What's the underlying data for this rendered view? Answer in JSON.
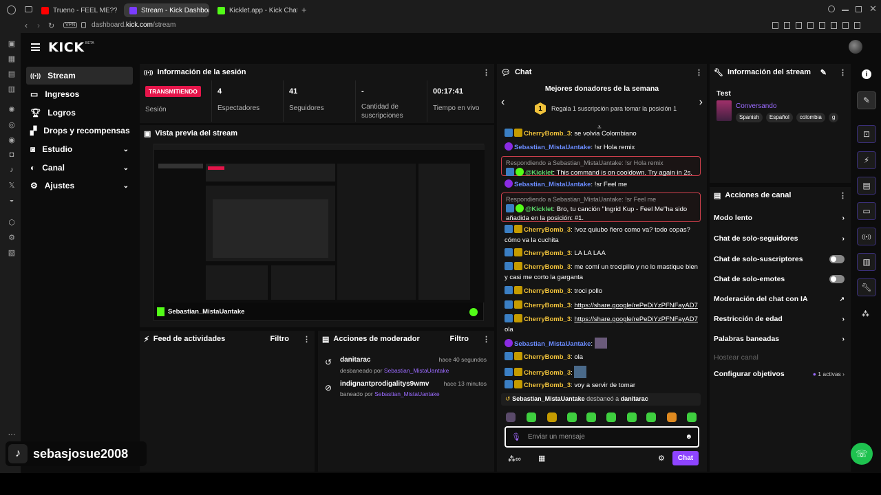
{
  "browser": {
    "tabs": [
      {
        "title": "Trueno - FEEL ME?? (Vide",
        "color": "#ff0000"
      },
      {
        "title": "Stream - Kick Dashboard",
        "color": "#7a3cff"
      },
      {
        "title": "Kicklet.app - Kick Chatbo",
        "color": "#53fc18"
      }
    ],
    "url_prefix": "dashboard.",
    "url_domain": "kick.com",
    "url_path": "/stream",
    "vpn": "VPN"
  },
  "logo": "KICK",
  "logo_beta": "BETA",
  "nav": [
    {
      "label": "Stream",
      "icon": "broadcast-icon"
    },
    {
      "label": "Ingresos",
      "icon": "money-icon"
    },
    {
      "label": "Logros",
      "icon": "trophy-icon"
    },
    {
      "label": "Drops y recompensas",
      "icon": "gift-icon"
    },
    {
      "label": "Estudio",
      "icon": "studio-icon"
    },
    {
      "label": "Canal",
      "icon": "channel-icon"
    },
    {
      "label": "Ajustes",
      "icon": "gear-icon"
    }
  ],
  "session": {
    "title": "Información de la sesión",
    "live_badge": "TRANSMITIENDO",
    "live_label": "Sesión",
    "stats": [
      {
        "value": "4",
        "label": "Espectadores"
      },
      {
        "value": "41",
        "label": "Seguidores"
      },
      {
        "value": "-",
        "label": "Cantidad de suscripciones"
      },
      {
        "value": "00:17:41",
        "label": "Tiempo en vivo"
      }
    ]
  },
  "preview": {
    "title": "Vista previa del stream",
    "channel": "Sebastian_MistaUantake"
  },
  "activity": {
    "title": "Feed de actividades",
    "filter": "Filtro"
  },
  "mod_actions": {
    "title": "Acciones de moderador",
    "filter": "Filtro",
    "items": [
      {
        "user": "danitarac",
        "time": "hace 40 segundos",
        "action": "desbaneado por",
        "by": "Sebastian_MistaUantake"
      },
      {
        "user": "indignantprodigalitys9wmv",
        "time": "hace 13 minutos",
        "action": "baneado por",
        "by": "Sebastian_MistaUantake"
      }
    ]
  },
  "chat": {
    "title": "Chat",
    "top_title": "Mejores donadores de la semana",
    "top_rank": "1",
    "top_text": "Regala 1 suscripción para tomar la posición 1",
    "messages": [
      {
        "user": "CherryBomb_3",
        "text": "se volvia Colombiano"
      },
      {
        "user": "Sebastian_MistaUantake",
        "text": "!sr Hola remix"
      },
      {
        "reply_to": "Respondiendo a Sebastian_MistaUantake: !sr Hola remix",
        "user": "@Kicklet",
        "text": "This command is on cooldown. Try again in 2s."
      },
      {
        "user": "Sebastian_MistaUantake",
        "text": "!sr Feel me"
      },
      {
        "reply_to": "Respondiendo a Sebastian_MistaUantake: !sr Feel me",
        "user": "@Kicklet",
        "text": "Bro, tu canción \"Ingrid Kup - Feel Me\"ha sido añadida en la posición: #1."
      },
      {
        "user": "CherryBomb_3",
        "text": "!voz quiubo ñero como va? todo copas? cómo va la cuchita"
      },
      {
        "user": "CherryBomb_3",
        "text": "LA LA LAA"
      },
      {
        "user": "CherryBomb_3",
        "text": "me comí un trocipillo y no lo mastique bien y casi me corto la garganta"
      },
      {
        "user": "CherryBomb_3",
        "text": "troci pollo"
      },
      {
        "user": "CherryBomb_3",
        "text": "https://share.google/rePeDiYzPFNFayAD7"
      },
      {
        "user": "CherryBomb_3",
        "text": "https://share.google/rePeDiYzPFNFayAD7",
        "extra": "ola"
      },
      {
        "user": "Sebastian_MistaUantake",
        "text": ""
      },
      {
        "user": "CherryBomb_3",
        "text": "ola"
      },
      {
        "user": "CherryBomb_3",
        "text": ""
      },
      {
        "user": "CherryBomb_3",
        "text": "voy a servir de tomar"
      }
    ],
    "system": {
      "user": "Sebastian_MistaUantake",
      "action": "desbaneó a",
      "target": "danitarac"
    },
    "placeholder": "Enviar un mensaje",
    "send": "Chat"
  },
  "stream_info": {
    "title": "Información del stream",
    "stream_title": "Test",
    "category": "Conversando",
    "tags": [
      "Spanish",
      "Español",
      "colombia",
      "g"
    ]
  },
  "channel_actions": {
    "title": "Acciones de canal",
    "items": [
      {
        "label": "Modo lento"
      },
      {
        "label": "Chat de solo-seguidores"
      },
      {
        "label": "Chat de solo-suscriptores"
      },
      {
        "label": "Chat de solo-emotes"
      },
      {
        "label": "Moderación del chat con IA"
      },
      {
        "label": "Restricción de edad"
      },
      {
        "label": "Palabras baneadas"
      },
      {
        "label": "Hostear canal"
      },
      {
        "label": "Configurar objetivos",
        "extra": "1 activas"
      }
    ]
  },
  "overlay": {
    "username": "sebasjosue2008"
  },
  "colors": {
    "accent": "#53fc18",
    "live": "#e5154a",
    "purple": "#8e44ff",
    "gold": "#f0c23b"
  }
}
